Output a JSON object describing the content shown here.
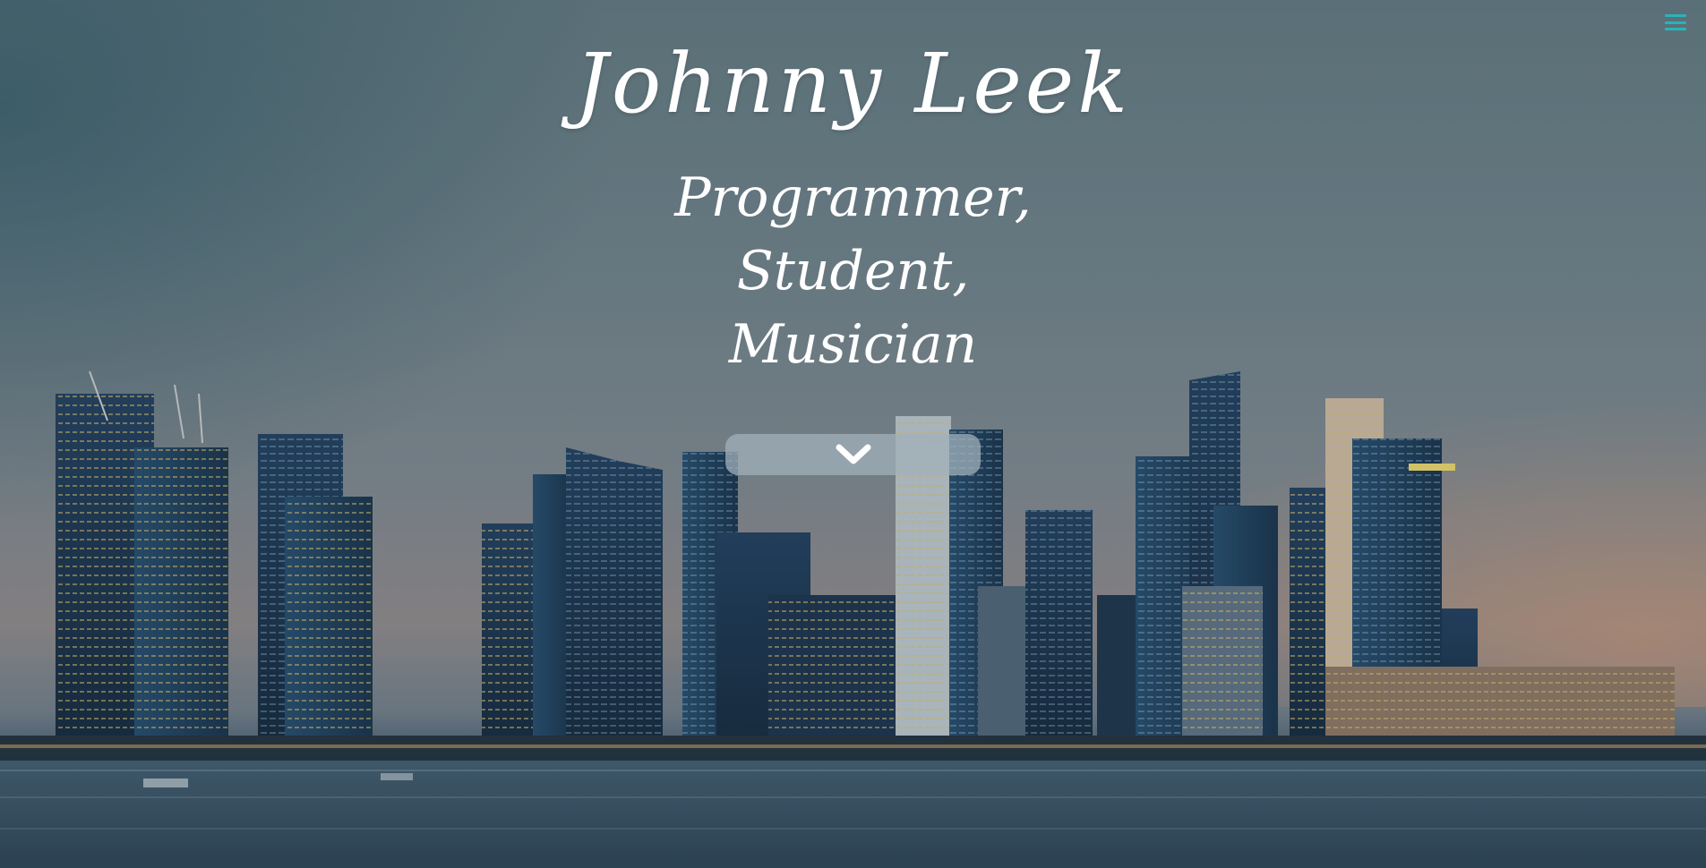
{
  "hero": {
    "title": "Johnny Leek",
    "roles": [
      "Programmer,",
      "Student,",
      "Musician"
    ]
  },
  "nav": {
    "menu_icon": "hamburger-menu-icon",
    "menu_color": "#2bb3b8"
  },
  "scroll_down": {
    "icon": "chevron-down-icon"
  }
}
